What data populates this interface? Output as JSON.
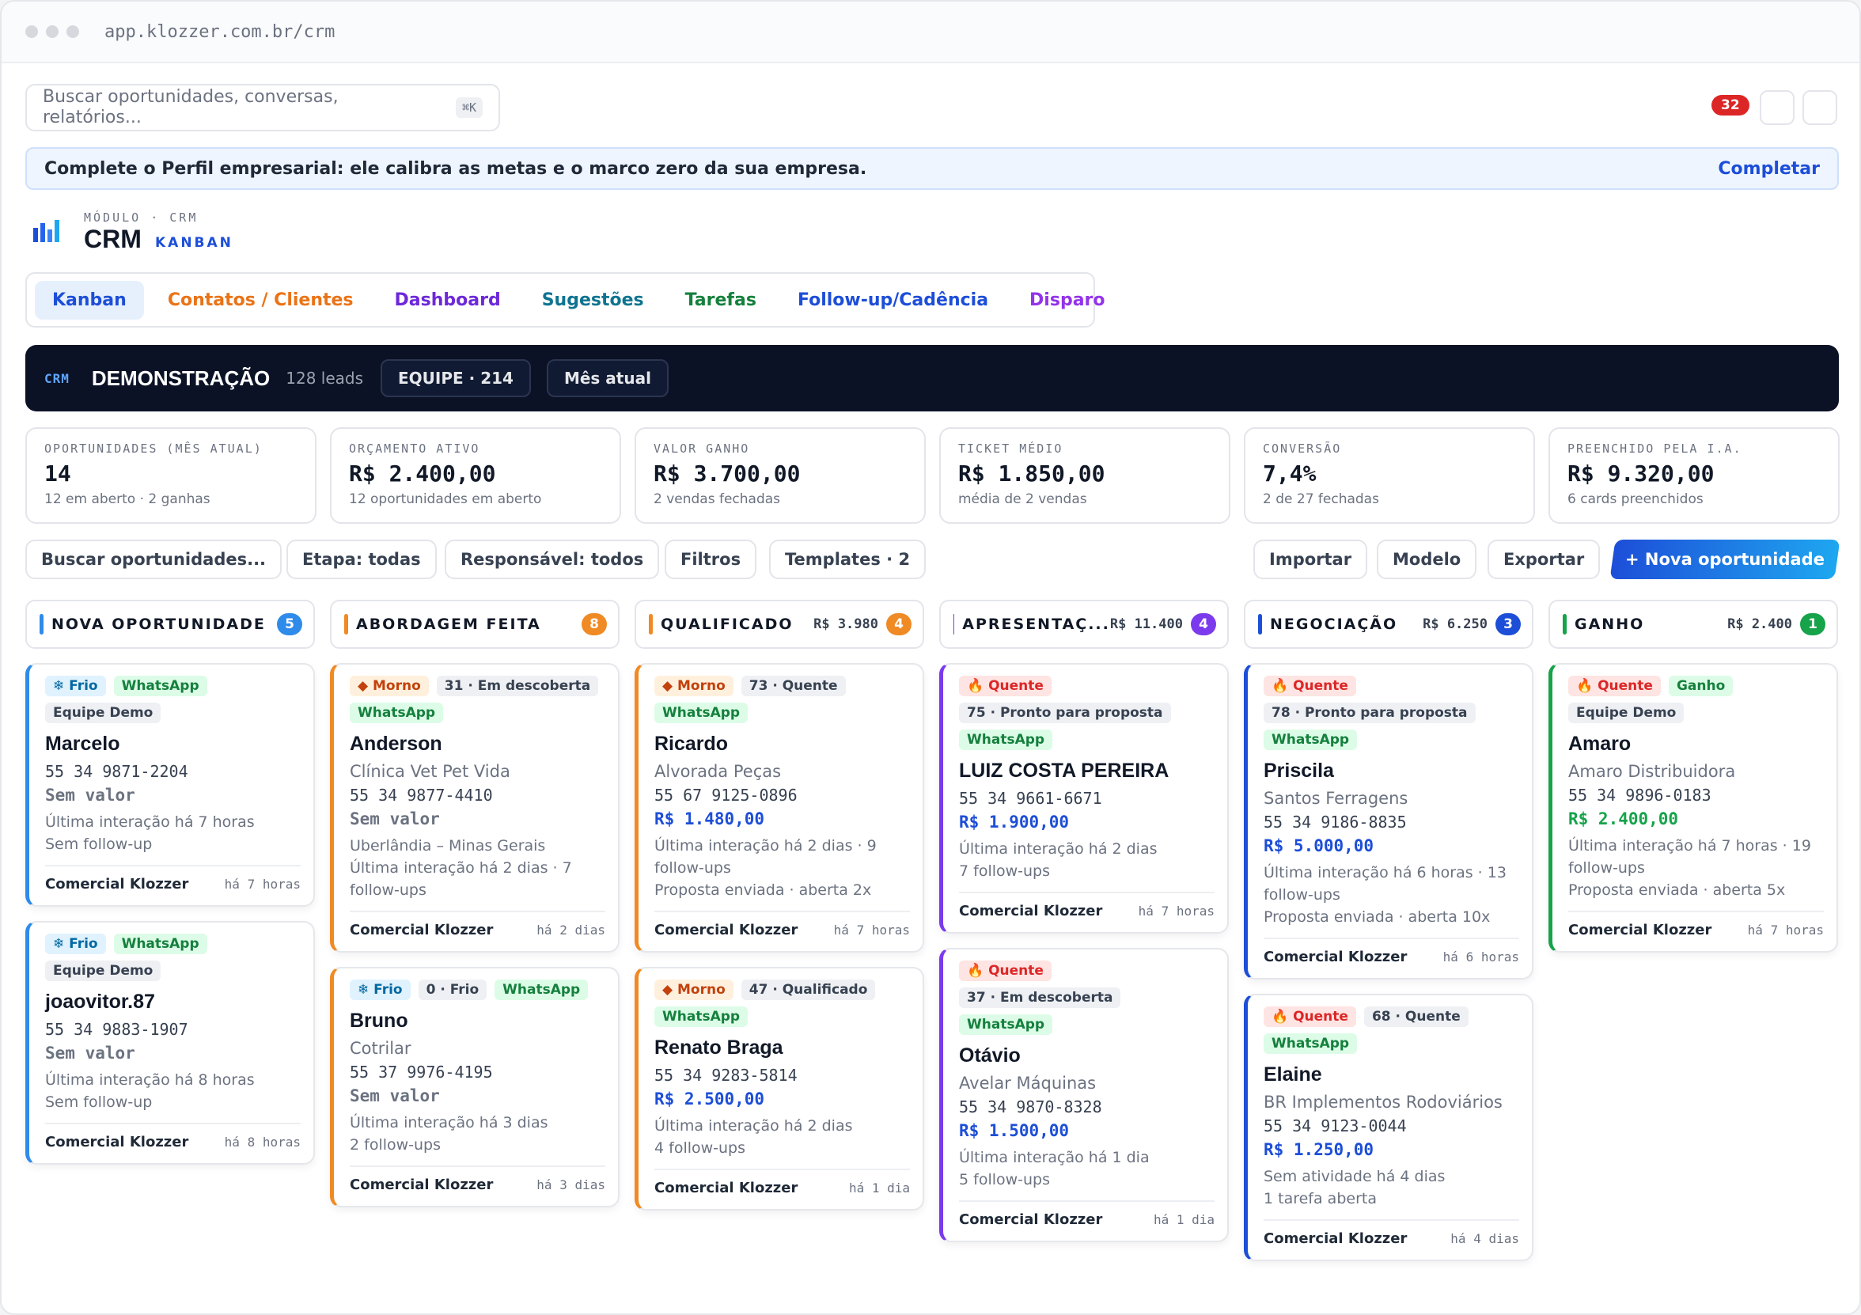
{
  "browser": {
    "url": "app.klozzer.com.br/crm"
  },
  "search": {
    "placeholder": "Buscar oportunidades, conversas, relatórios...",
    "shortcut": "⌘K"
  },
  "notifications": {
    "count": "32"
  },
  "banner": {
    "text": "Complete o Perfil empresarial: ele calibra as metas e o marco zero da sua empresa.",
    "action": "Completar"
  },
  "module": {
    "kicker": "MÓDULO · CRM",
    "title": "CRM",
    "subtitle": "KANBAN"
  },
  "tabs": [
    {
      "label": "Kanban",
      "color": "#1d4ed8"
    },
    {
      "label": "Contatos / Clientes",
      "color": "#ea7317"
    },
    {
      "label": "Dashboard",
      "color": "#6d28d9"
    },
    {
      "label": "Sugestões",
      "color": "#0e7490"
    },
    {
      "label": "Tarefas",
      "color": "#15803d"
    },
    {
      "label": "Follow-up/Cadência",
      "color": "#1d4ed8"
    },
    {
      "label": "Disparo",
      "color": "#9333ea"
    }
  ],
  "hero": {
    "kicker": "CRM",
    "title": "DEMONSTRAÇÃO",
    "leads": "128 leads",
    "team": "EQUIPE · 214",
    "period": "Mês atual"
  },
  "stats": [
    {
      "label": "OPORTUNIDADES (MÊS ATUAL)",
      "value": "14",
      "sub": "12 em aberto · 2 ganhas"
    },
    {
      "label": "ORÇAMENTO ATIVO",
      "value": "R$ 2.400,00",
      "sub": "12 oportunidades em aberto"
    },
    {
      "label": "VALOR GANHO",
      "value": "R$ 3.700,00",
      "sub": "2 vendas fechadas"
    },
    {
      "label": "TICKET MÉDIO",
      "value": "R$ 1.850,00",
      "sub": "média de 2 vendas"
    },
    {
      "label": "CONVERSÃO",
      "value": "7,4%",
      "sub": "2 de 27 fechadas"
    },
    {
      "label": "PREENCHIDO PELA I.A.",
      "value": "R$ 9.320,00",
      "sub": "6 cards preenchidos"
    }
  ],
  "filters": {
    "search": "Buscar oportunidades...",
    "stage": "Etapa: todas",
    "owner": "Responsável: todos",
    "filters": "Filtros",
    "templates": "Templates · 2",
    "import": "Importar",
    "model": "Modelo",
    "export": "Exportar",
    "new": "+ Nova oportunidade"
  },
  "columns": [
    {
      "title": "NOVA OPORTUNIDADE",
      "sum": "",
      "count": "5",
      "color": "#2e8bea"
    },
    {
      "title": "ABORDAGEM FEITA",
      "sum": "",
      "count": "8",
      "color": "#f08a24"
    },
    {
      "title": "QUALIFICADO",
      "sum": "R$ 3.980",
      "count": "4",
      "color": "#f08a24"
    },
    {
      "title": "APRESENTAÇ...",
      "sum": "R$ 11.400",
      "count": "4",
      "color": "#7c3aed"
    },
    {
      "title": "NEGOCIAÇÃO",
      "sum": "R$ 6.250",
      "count": "3",
      "color": "#1d4ed8"
    },
    {
      "title": "GANHO",
      "sum": "R$ 2.400",
      "count": "1",
      "color": "#16a34a"
    }
  ],
  "cards": [
    {
      "col": 0,
      "tags": [
        [
          "❄ Frio",
          "t-frio"
        ],
        [
          "WhatsApp",
          "t-wa"
        ],
        [
          "Equipe Demo",
          "t-gray"
        ]
      ],
      "name": "Marcelo",
      "company": "",
      "phone": "55 34 9871-2204",
      "value": "Sem valor",
      "valueType": "v-none",
      "lines": [
        "Última interação há 7 horas",
        "Sem follow-up"
      ],
      "owner": "Comercial Klozzer",
      "ago": "há 7 horas"
    },
    {
      "col": 0,
      "tags": [
        [
          "❄ Frio",
          "t-frio"
        ],
        [
          "WhatsApp",
          "t-wa"
        ],
        [
          "Equipe Demo",
          "t-gray"
        ]
      ],
      "name": "joaovitor.87",
      "company": "",
      "phone": "55 34 9883-1907",
      "value": "Sem valor",
      "valueType": "v-none",
      "lines": [
        "Última interação há 8 horas",
        "Sem follow-up"
      ],
      "owner": "Comercial Klozzer",
      "ago": "há 8 horas"
    },
    {
      "col": 1,
      "tags": [
        [
          "◆ Morno",
          "t-morno"
        ],
        [
          "31 · Em descoberta",
          "t-gray"
        ],
        [
          "WhatsApp",
          "t-wa"
        ]
      ],
      "name": "Anderson",
      "company": "Clínica Vet Pet Vida",
      "phone": "55 34 9877-4410",
      "value": "Sem valor",
      "valueType": "v-none",
      "lines": [
        "Uberlândia – Minas Gerais",
        "Última interação há 2 dias · 7 follow-ups"
      ],
      "owner": "Comercial Klozzer",
      "ago": "há 2 dias"
    },
    {
      "col": 1,
      "tags": [
        [
          "❄ Frio",
          "t-frio"
        ],
        [
          "0 · Frio",
          "t-gray"
        ],
        [
          "WhatsApp",
          "t-wa"
        ]
      ],
      "name": "Bruno",
      "company": "Cotrilar",
      "phone": "55 37 9976-4195",
      "value": "Sem valor",
      "valueType": "v-none",
      "lines": [
        "Última interação há 3 dias",
        "2 follow-ups"
      ],
      "owner": "Comercial Klozzer",
      "ago": "há 3 dias"
    },
    {
      "col": 2,
      "tags": [
        [
          "◆ Morno",
          "t-morno"
        ],
        [
          "73 · Quente",
          "t-gray"
        ],
        [
          "WhatsApp",
          "t-wa"
        ]
      ],
      "name": "Ricardo",
      "company": "Alvorada Peças",
      "phone": "55 67 9125-0896",
      "value": "R$ 1.480,00",
      "valueType": "v-blue",
      "lines": [
        "Última interação há 2 dias · 9 follow-ups",
        "Proposta enviada · aberta 2x"
      ],
      "owner": "Comercial Klozzer",
      "ago": "há 7 horas"
    },
    {
      "col": 2,
      "tags": [
        [
          "◆ Morno",
          "t-morno"
        ],
        [
          "47 · Qualificado",
          "t-gray"
        ],
        [
          "WhatsApp",
          "t-wa"
        ]
      ],
      "name": "Renato Braga",
      "company": "",
      "phone": "55 34 9283-5814",
      "value": "R$ 2.500,00",
      "valueType": "v-blue",
      "lines": [
        "Última interação há 2 dias",
        "4 follow-ups"
      ],
      "owner": "Comercial Klozzer",
      "ago": "há 1 dia"
    },
    {
      "col": 3,
      "tags": [
        [
          "🔥 Quente",
          "t-quente"
        ],
        [
          "75 · Pronto para proposta",
          "t-gray"
        ],
        [
          "WhatsApp",
          "t-wa"
        ]
      ],
      "name": "LUIZ COSTA PEREIRA",
      "company": "",
      "phone": "55 34 9661-6671",
      "value": "R$ 1.900,00",
      "valueType": "v-blue",
      "lines": [
        "Última interação há 2 dias",
        "7 follow-ups"
      ],
      "owner": "Comercial Klozzer",
      "ago": "há 7 horas"
    },
    {
      "col": 3,
      "tags": [
        [
          "🔥 Quente",
          "t-quente"
        ],
        [
          "37 · Em descoberta",
          "t-gray"
        ],
        [
          "WhatsApp",
          "t-wa"
        ]
      ],
      "name": "Otávio",
      "company": "Avelar Máquinas",
      "phone": "55 34 9870-8328",
      "value": "R$ 1.500,00",
      "valueType": "v-blue",
      "lines": [
        "Última interação há 1 dia",
        "5 follow-ups"
      ],
      "owner": "Comercial Klozzer",
      "ago": "há 1 dia"
    },
    {
      "col": 4,
      "tags": [
        [
          "🔥 Quente",
          "t-quente"
        ],
        [
          "78 · Pronto para proposta",
          "t-gray"
        ],
        [
          "WhatsApp",
          "t-wa"
        ]
      ],
      "name": "Priscila",
      "company": "Santos Ferragens",
      "phone": "55 34 9186-8835",
      "value": "R$ 5.000,00",
      "valueType": "v-blue",
      "lines": [
        "Última interação há 6 horas · 13 follow-ups",
        "Proposta enviada · aberta 10x"
      ],
      "owner": "Comercial Klozzer",
      "ago": "há 6 horas"
    },
    {
      "col": 4,
      "tags": [
        [
          "🔥 Quente",
          "t-quente"
        ],
        [
          "68 · Quente",
          "t-gray"
        ],
        [
          "WhatsApp",
          "t-wa"
        ]
      ],
      "name": "Elaine",
      "company": "BR Implementos Rodoviários",
      "phone": "55 34 9123-0044",
      "value": "R$ 1.250,00",
      "valueType": "v-blue",
      "lines": [
        "Sem atividade há 4 dias",
        "1 tarefa aberta"
      ],
      "owner": "Comercial Klozzer",
      "ago": "há 4 dias"
    },
    {
      "col": 5,
      "tags": [
        [
          "🔥 Quente",
          "t-quente"
        ],
        [
          "Ganho",
          "t-ganho"
        ],
        [
          "Equipe Demo",
          "t-gray"
        ]
      ],
      "name": "Amaro",
      "company": "Amaro Distribuidora",
      "phone": "55 34 9896-0183",
      "value": "R$ 2.400,00",
      "valueType": "v-green",
      "lines": [
        "Última interação há 7 horas · 19 follow-ups",
        "Proposta enviada · aberta 5x"
      ],
      "owner": "Comercial Klozzer",
      "ago": "há 7 horas"
    }
  ]
}
